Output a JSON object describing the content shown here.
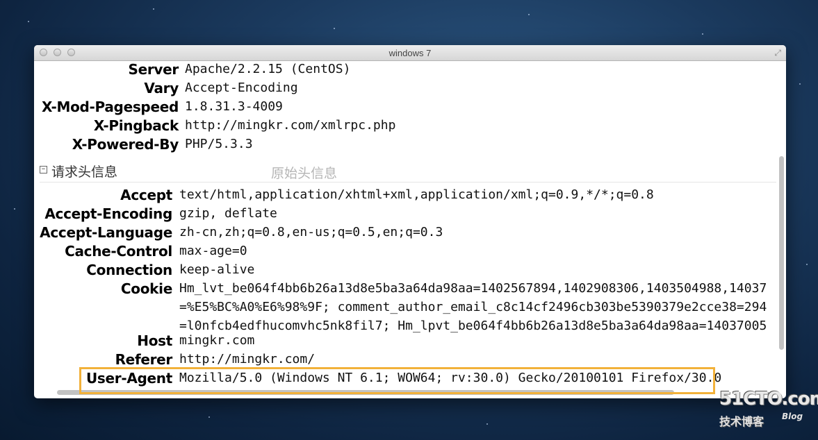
{
  "window": {
    "title": "windows 7"
  },
  "response_headers": [
    {
      "name": "Server",
      "value": "Apache/2.2.15 (CentOS)"
    },
    {
      "name": "Vary",
      "value": "Accept-Encoding"
    },
    {
      "name": "X-Mod-Pagespeed",
      "value": "1.8.31.3-4009"
    },
    {
      "name": "X-Pingback",
      "value": "http://mingkr.com/xmlrpc.php"
    },
    {
      "name": "X-Powered-By",
      "value": "PHP/5.3.3"
    }
  ],
  "request_section": {
    "collapse_symbol": "−",
    "title": "请求头信息",
    "raw_toggle": "原始头信息"
  },
  "request_headers": [
    {
      "name": "Accept",
      "value": "text/html,application/xhtml+xml,application/xml;q=0.9,*/*;q=0.8"
    },
    {
      "name": "Accept-Encoding",
      "value": "gzip, deflate"
    },
    {
      "name": "Accept-Language",
      "value": "zh-cn,zh;q=0.8,en-us;q=0.5,en;q=0.3"
    },
    {
      "name": "Cache-Control",
      "value": "max-age=0"
    },
    {
      "name": "Connection",
      "value": "keep-alive"
    },
    {
      "name": "Cookie",
      "value_lines": [
        "Hm_lvt_be064f4bb6b26a13d8e5ba3a64da98aa=1402567894,1402908306,1403504988,14037",
        "=%E5%BC%A0%E6%98%9F; comment_author_email_c8c14cf2496cb303be5390379e2cce38=294",
        "=l0nfcb4edfhucomvhc5nk8fil7; Hm_lpvt_be064f4bb6b26a13d8e5ba3a64da98aa=14037005"
      ]
    },
    {
      "name": "Host",
      "value": "mingkr.com"
    },
    {
      "name": "Referer",
      "value": "http://mingkr.com/"
    },
    {
      "name": "User-Agent",
      "value": "Mozilla/5.0 (Windows NT 6.1; WOW64; rv:30.0) Gecko/20100101 Firefox/30.0"
    }
  ],
  "watermark": {
    "logo": "51CTO.com",
    "subtitle": "技术博客",
    "blog": "Blog"
  }
}
